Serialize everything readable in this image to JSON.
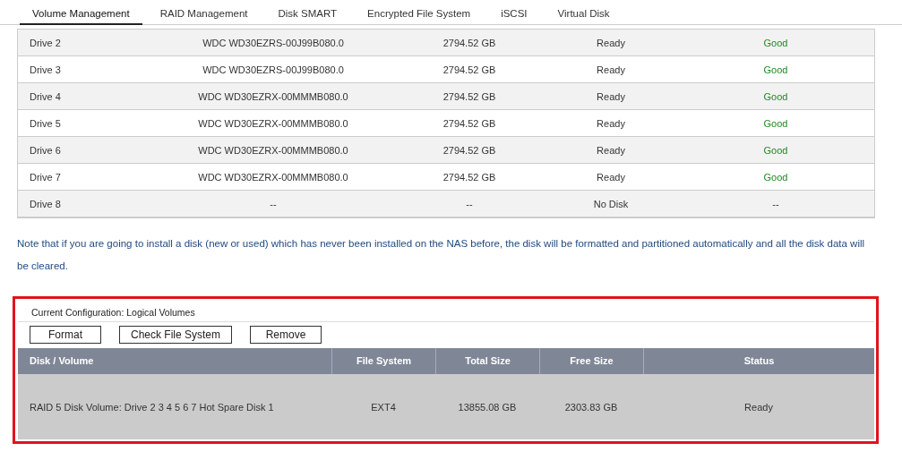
{
  "tabs": [
    {
      "label": "Volume Management",
      "selected": true
    },
    {
      "label": "RAID Management",
      "selected": false
    },
    {
      "label": "Disk SMART",
      "selected": false
    },
    {
      "label": "Encrypted File System",
      "selected": false
    },
    {
      "label": "iSCSI",
      "selected": false
    },
    {
      "label": "Virtual Disk",
      "selected": false
    }
  ],
  "disks": [
    {
      "drive": "Drive 2",
      "model": "WDC WD30EZRS-00J99B080.0",
      "capacity": "2794.52 GB",
      "status": "Ready",
      "health": "Good",
      "health_ok": true
    },
    {
      "drive": "Drive 3",
      "model": "WDC WD30EZRS-00J99B080.0",
      "capacity": "2794.52 GB",
      "status": "Ready",
      "health": "Good",
      "health_ok": true
    },
    {
      "drive": "Drive 4",
      "model": "WDC WD30EZRX-00MMMB080.0",
      "capacity": "2794.52 GB",
      "status": "Ready",
      "health": "Good",
      "health_ok": true
    },
    {
      "drive": "Drive 5",
      "model": "WDC WD30EZRX-00MMMB080.0",
      "capacity": "2794.52 GB",
      "status": "Ready",
      "health": "Good",
      "health_ok": true
    },
    {
      "drive": "Drive 6",
      "model": "WDC WD30EZRX-00MMMB080.0",
      "capacity": "2794.52 GB",
      "status": "Ready",
      "health": "Good",
      "health_ok": true
    },
    {
      "drive": "Drive 7",
      "model": "WDC WD30EZRX-00MMMB080.0",
      "capacity": "2794.52 GB",
      "status": "Ready",
      "health": "Good",
      "health_ok": true
    },
    {
      "drive": "Drive 8",
      "model": "--",
      "capacity": "--",
      "status": "No Disk",
      "health": "--",
      "health_ok": false
    }
  ],
  "note": "Note that if you are going to install a disk (new or used) which has never been installed on the NAS before, the disk will be formatted and partitioned automatically and all the disk data will be cleared.",
  "logical_volumes": {
    "title": "Current Configuration: Logical Volumes",
    "buttons": [
      "Format",
      "Check File System",
      "Remove"
    ],
    "columns": [
      "Disk / Volume",
      "File System",
      "Total Size",
      "Free Size",
      "Status"
    ],
    "rows": [
      [
        "RAID 5 Disk Volume: Drive 2 3 4 5 6 7 Hot Spare Disk 1",
        "EXT4",
        "13855.08 GB",
        "2303.83 GB",
        "Ready"
      ]
    ]
  }
}
